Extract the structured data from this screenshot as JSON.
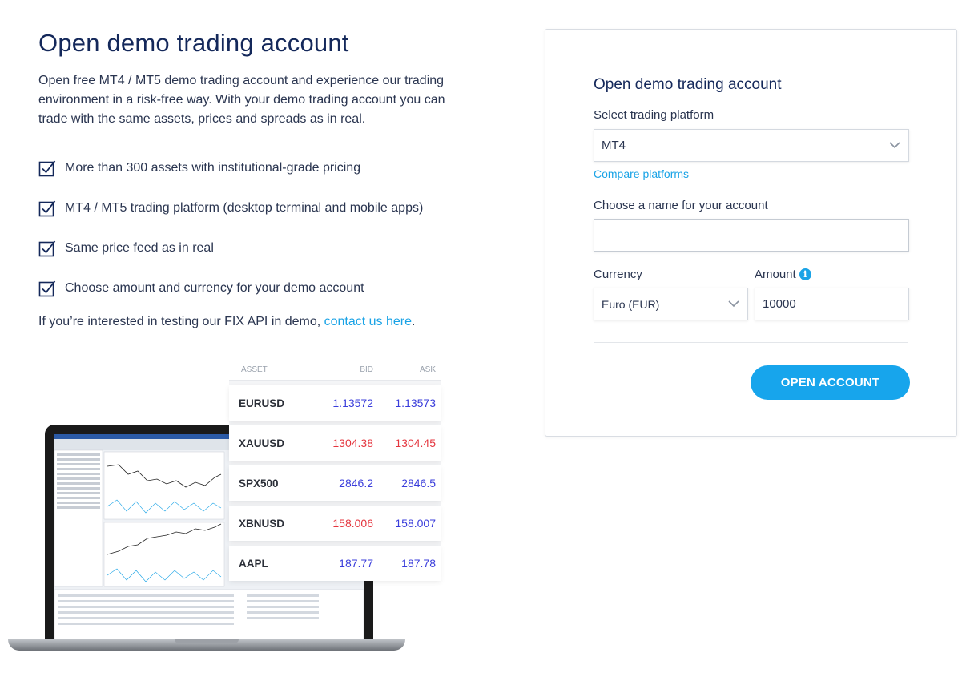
{
  "page": {
    "title": "Open demo trading account",
    "intro": "Open free MT4 / MT5 demo trading account and experience our trading environment in a risk-free way. With your demo trading account you can trade with the same assets, prices and spreads as in real.",
    "features": [
      "More than 300 assets with institutional-grade pricing",
      "MT4 / MT5 trading platform (desktop terminal and mobile apps)",
      "Same price feed as in real",
      "Choose amount and currency for your demo account"
    ],
    "fix_note_prefix": "If you’re interested in testing our FIX API in demo, ",
    "fix_note_link": "contact us here",
    "fix_note_suffix": "."
  },
  "assets": {
    "headers": {
      "asset": "ASSET",
      "bid": "BID",
      "ask": "ASK"
    },
    "rows": [
      {
        "name": "EURUSD",
        "bid": "1.13572",
        "ask": "1.13573",
        "direction": "up"
      },
      {
        "name": "XAUUSD",
        "bid": "1304.38",
        "ask": "1304.45",
        "direction": "down"
      },
      {
        "name": "SPX500",
        "bid": "2846.2",
        "ask": "2846.5",
        "direction": "up"
      },
      {
        "name": "XBNUSD",
        "bid": "158.006",
        "ask": "158.007",
        "direction": "mixed"
      },
      {
        "name": "AAPL",
        "bid": "187.77",
        "ask": "187.78",
        "direction": "up"
      }
    ]
  },
  "form": {
    "title": "Open demo trading account",
    "platform_label": "Select trading platform",
    "platform_value": "MT4",
    "compare_link": "Compare platforms",
    "name_label": "Choose a name for your account",
    "name_value": "",
    "currency_label": "Currency",
    "currency_value": "Euro (EUR)",
    "amount_label": "Amount",
    "amount_value": "10000",
    "submit_label": "OPEN ACCOUNT"
  },
  "colors": {
    "accent": "#17a5ec",
    "title": "#14285a",
    "price_up": "#3a3ddb",
    "price_down": "#e4363f"
  },
  "icons": [
    "checkbox-checked-icon",
    "chevron-down-icon",
    "info-icon"
  ]
}
